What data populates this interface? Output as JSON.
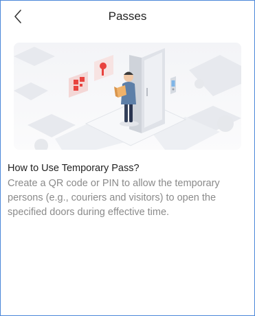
{
  "header": {
    "title": "Passes",
    "back_icon": "chevron-left-icon"
  },
  "illustration": {
    "name": "temporary-pass-illustration",
    "accent_color": "#e8433f",
    "icons": [
      "door-icon",
      "key-icon",
      "qr-code-icon",
      "card-reader-icon",
      "courier-person-icon",
      "parcel-icon"
    ]
  },
  "content": {
    "heading": "How to Use Temporary Pass?",
    "description_lines": [
      "Create a QR code or PIN to allow the temporary",
      "persons (e.g., couriers and visitors) to open the",
      "specified doors during effective time."
    ]
  },
  "colors": {
    "frame_border": "#4a86d8",
    "title_text": "#222222",
    "description_text": "#8a8a8a"
  }
}
